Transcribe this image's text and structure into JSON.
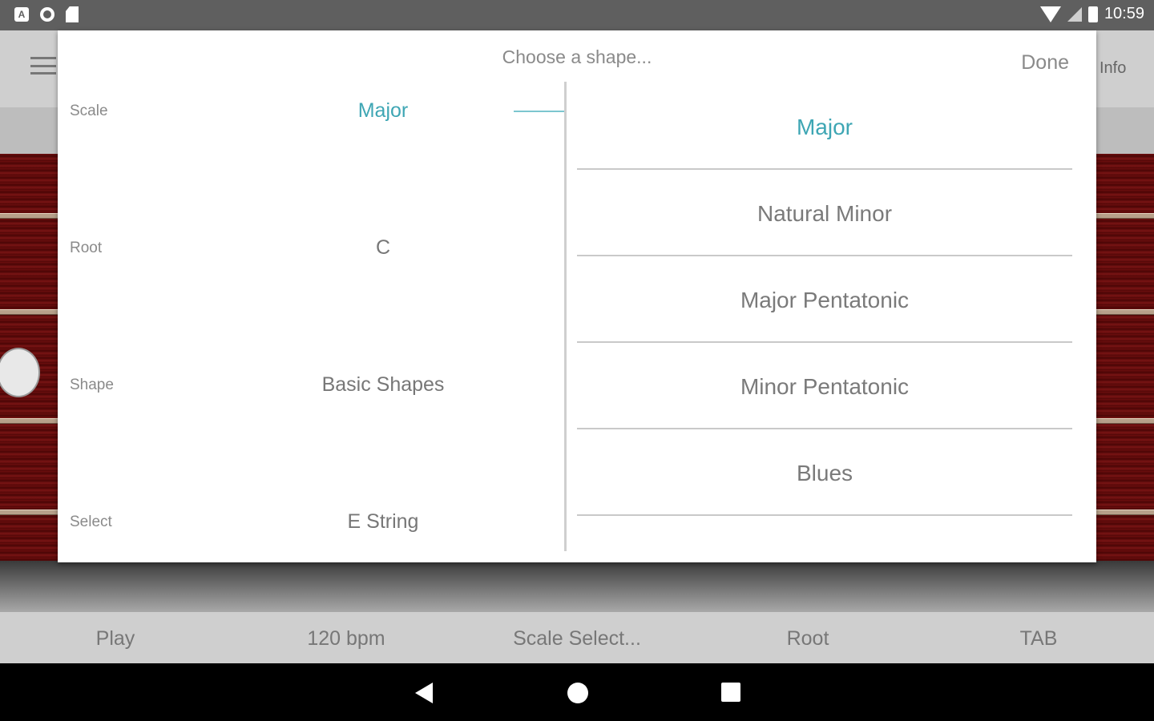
{
  "status_bar": {
    "left_icons": [
      "a-box-icon",
      "circle-icon",
      "sd-card-icon"
    ],
    "time": "10:59"
  },
  "app": {
    "info_label": "Info",
    "bottom_bar": [
      "Play",
      "120 bpm",
      "Scale Select...",
      "Root",
      "TAB"
    ]
  },
  "dialog": {
    "title": "Choose a shape...",
    "done_label": "Done",
    "rows": [
      {
        "label": "Scale",
        "value": "Major"
      },
      {
        "label": "Root",
        "value": "C"
      },
      {
        "label": "Shape",
        "value": "Basic Shapes"
      },
      {
        "label": "Select",
        "value": "E String"
      }
    ],
    "options": [
      "Major",
      "Natural Minor",
      "Major Pentatonic",
      "Minor Pentatonic",
      "Blues"
    ],
    "selected_option": "Major"
  },
  "colors": {
    "accent": "#3ea6b4",
    "status_bar": "#5f5f5f",
    "app_bar": "#cfcfcf"
  }
}
